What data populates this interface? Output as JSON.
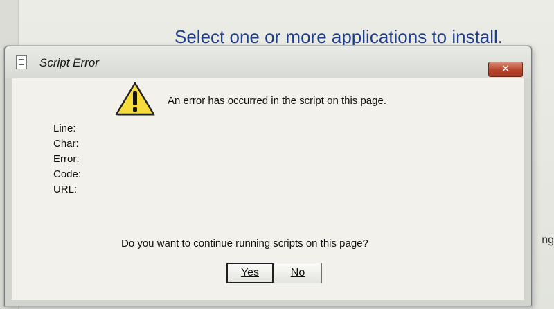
{
  "background": {
    "heading": "Select one or more applications to install.",
    "right_fragment": "ng"
  },
  "dialog": {
    "title": "Script Error",
    "close_label": "✕",
    "message": "An error has occurred in the script on this page.",
    "fields": {
      "line": "Line:",
      "char": "Char:",
      "error": "Error:",
      "code": "Code:",
      "url": "URL:"
    },
    "question": "Do you want to continue running scripts on this page?",
    "buttons": {
      "yes": "Yes",
      "no": "No"
    },
    "icons": {
      "title": "script-document-icon",
      "warning": "warning-triangle-icon",
      "close": "close-icon"
    },
    "colors": {
      "warning_fill": "#f5dc3c",
      "close_button": "#b9432a",
      "heading": "#1f3f8a"
    }
  }
}
